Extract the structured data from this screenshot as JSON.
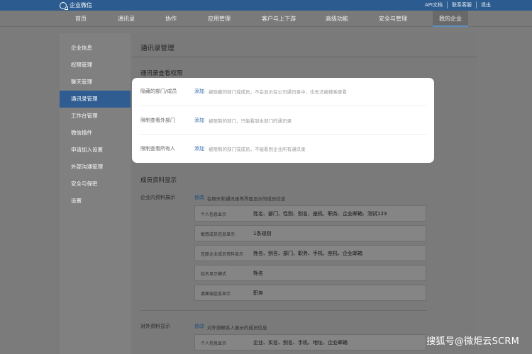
{
  "app": {
    "title": "企业微信"
  },
  "top_links": [
    "API文档",
    "联系客服",
    "退出"
  ],
  "nav": {
    "items": [
      "首页",
      "通讯录",
      "协作",
      "应用管理",
      "客户与上下游",
      "高级功能",
      "安全与管理",
      "我的企业"
    ],
    "active_index": 7
  },
  "sidebar": {
    "items": [
      "企业信息",
      "权限管理",
      "聊天管理",
      "通讯录管理",
      "工作台管理",
      "微信插件",
      "申请加入设置",
      "外部沟通管理",
      "安全与保密",
      "设置"
    ],
    "active_index": 3
  },
  "main": {
    "page_title": "通讯录管理",
    "permissions": {
      "title": "通讯录查看权限",
      "rows": [
        {
          "label": "隐藏的部门/成员",
          "action": "添加",
          "desc": "被隐藏的部门或成员，不会显示在公司通讯录中，也无法被搜索查看"
        },
        {
          "label": "限制查看外部门",
          "action": "添加",
          "desc": "被限制的部门，只能看到本部门的通讯录"
        },
        {
          "label": "限制查看所有人",
          "action": "添加",
          "desc": "被限制的部门或成员，不能看到企业所有通讯录"
        }
      ]
    },
    "member_info": {
      "title": "成员资料显示",
      "internal": {
        "label": "企业内资料展示",
        "action": "修改",
        "desc": "在聊天和通讯录等界面显示的成员信息",
        "rows": [
          {
            "key": "个人信息显示",
            "value": "姓名、部门、性别、别名、座机、职务、企业邮箱、测试123"
          },
          {
            "key": "敏感成员信息显示",
            "value": "1条规则"
          },
          {
            "key": "互联企业成员资料显示",
            "value": "姓名、别名、部门、职务、手机、座机、企业邮箱"
          },
          {
            "key": "姓名显示模式",
            "value": "姓名"
          },
          {
            "key": "桌面端信息显示",
            "value": "职务"
          }
        ]
      },
      "external": {
        "label": "对外资料显示",
        "action": "修改",
        "desc": "对外部联系人展示的成员信息",
        "rows": [
          {
            "key": "个人信息显示",
            "value": "企业、实名、别名、手机、地址、企业邮箱"
          }
        ]
      }
    }
  },
  "watermark": "搜狐号@微炬云SCRM"
}
